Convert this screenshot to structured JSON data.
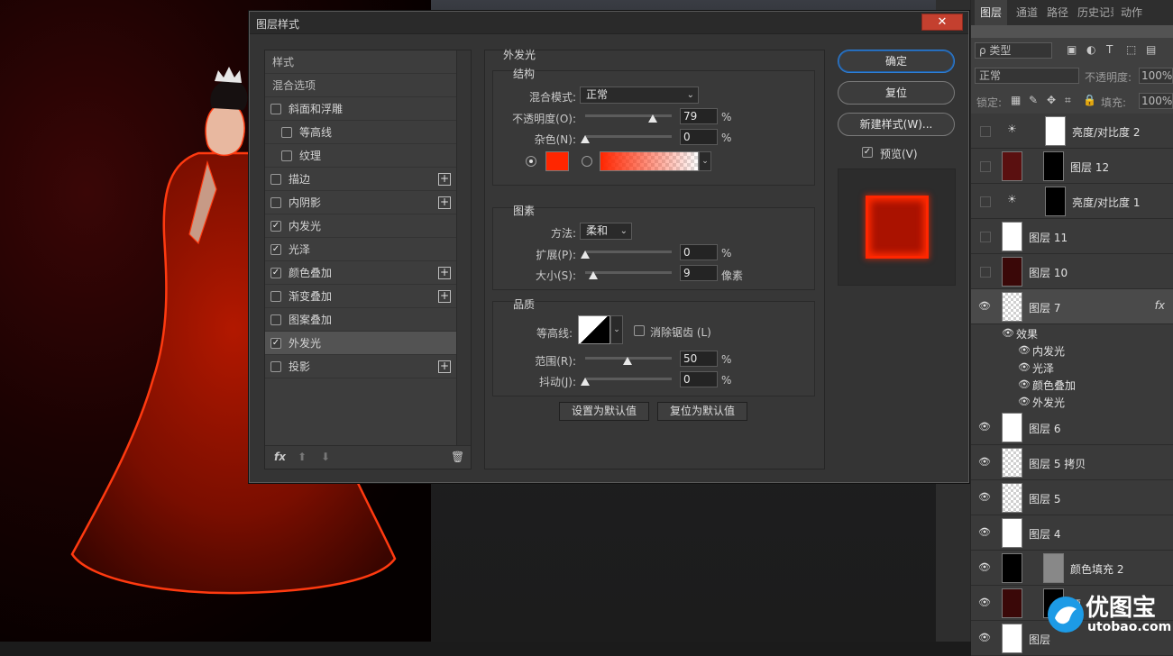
{
  "dialog": {
    "title": "图层样式",
    "close_glyph": "✕",
    "styles_list": {
      "header_styles": "样式",
      "header_blend": "混合选项",
      "items": [
        {
          "label": "斜面和浮雕",
          "checked": false,
          "indent": false,
          "plus": false
        },
        {
          "label": "等高线",
          "checked": false,
          "indent": true,
          "plus": false
        },
        {
          "label": "纹理",
          "checked": false,
          "indent": true,
          "plus": false
        },
        {
          "label": "描边",
          "checked": false,
          "indent": false,
          "plus": true
        },
        {
          "label": "内阴影",
          "checked": false,
          "indent": false,
          "plus": true
        },
        {
          "label": "内发光",
          "checked": true,
          "indent": false,
          "plus": false
        },
        {
          "label": "光泽",
          "checked": true,
          "indent": false,
          "plus": false
        },
        {
          "label": "颜色叠加",
          "checked": true,
          "indent": false,
          "plus": true
        },
        {
          "label": "渐变叠加",
          "checked": false,
          "indent": false,
          "plus": true
        },
        {
          "label": "图案叠加",
          "checked": false,
          "indent": false,
          "plus": false
        },
        {
          "label": "外发光",
          "checked": true,
          "indent": false,
          "plus": false,
          "active": true
        },
        {
          "label": "投影",
          "checked": false,
          "indent": false,
          "plus": true
        }
      ],
      "footer": {
        "fx": "fx",
        "up": "⬆",
        "down": "⬇",
        "trash": "🗑"
      }
    },
    "outer_glow": {
      "title": "外发光",
      "structure": {
        "title": "结构",
        "blend_mode_label": "混合模式:",
        "blend_mode_value": "正常",
        "opacity_label": "不透明度(O):",
        "opacity_value": "79",
        "noise_label": "杂色(N):",
        "noise_value": "0",
        "percent": "%",
        "glow_color": "#ff2600"
      },
      "elements": {
        "title": "图素",
        "technique_label": "方法:",
        "technique_value": "柔和",
        "spread_label": "扩展(P):",
        "spread_value": "0",
        "size_label": "大小(S):",
        "size_value": "9",
        "size_unit": "像素",
        "percent": "%"
      },
      "quality": {
        "title": "品质",
        "contour_label": "等高线:",
        "antialias_label": "消除锯齿 (L)",
        "range_label": "范围(R):",
        "range_value": "50",
        "jitter_label": "抖动(J):",
        "jitter_value": "0",
        "percent": "%"
      },
      "set_default": "设置为默认值",
      "reset_default": "复位为默认值"
    },
    "buttons": {
      "ok": "确定",
      "reset": "复位",
      "new_style": "新建样式(W)...",
      "preview_label": "预览(V)"
    }
  },
  "panel": {
    "tabs": [
      "图层",
      "通道",
      "路径",
      "历史记录",
      "动作"
    ],
    "filter_kind": "ρ 类型",
    "blend_mode": "正常",
    "opacity_label": "不透明度:",
    "opacity_value": "100%",
    "lock_label": "锁定:",
    "fill_label": "填充:",
    "fill_value": "100%",
    "layers": [
      {
        "name": "亮度/对比度 2",
        "visible": false
      },
      {
        "name": "图层 12",
        "visible": false
      },
      {
        "name": "亮度/对比度 1",
        "visible": false
      },
      {
        "name": "图层 11",
        "visible": false
      },
      {
        "name": "图层 10",
        "visible": false
      },
      {
        "name": "图层 7",
        "visible": true,
        "fx": "fx"
      },
      {
        "name": "图层 6",
        "visible": true
      },
      {
        "name": "图层 5 拷贝",
        "visible": true
      },
      {
        "name": "图层 5",
        "visible": true
      },
      {
        "name": "图层 4",
        "visible": true
      },
      {
        "name": "颜色填充 2",
        "visible": true
      },
      {
        "name": "颜",
        "visible": true
      },
      {
        "name": "图层",
        "visible": true
      }
    ],
    "effects_header": "效果",
    "effects": [
      "内发光",
      "光泽",
      "颜色叠加",
      "外发光"
    ]
  },
  "watermark": {
    "text": "优图宝",
    "sub": "utobao.com"
  }
}
